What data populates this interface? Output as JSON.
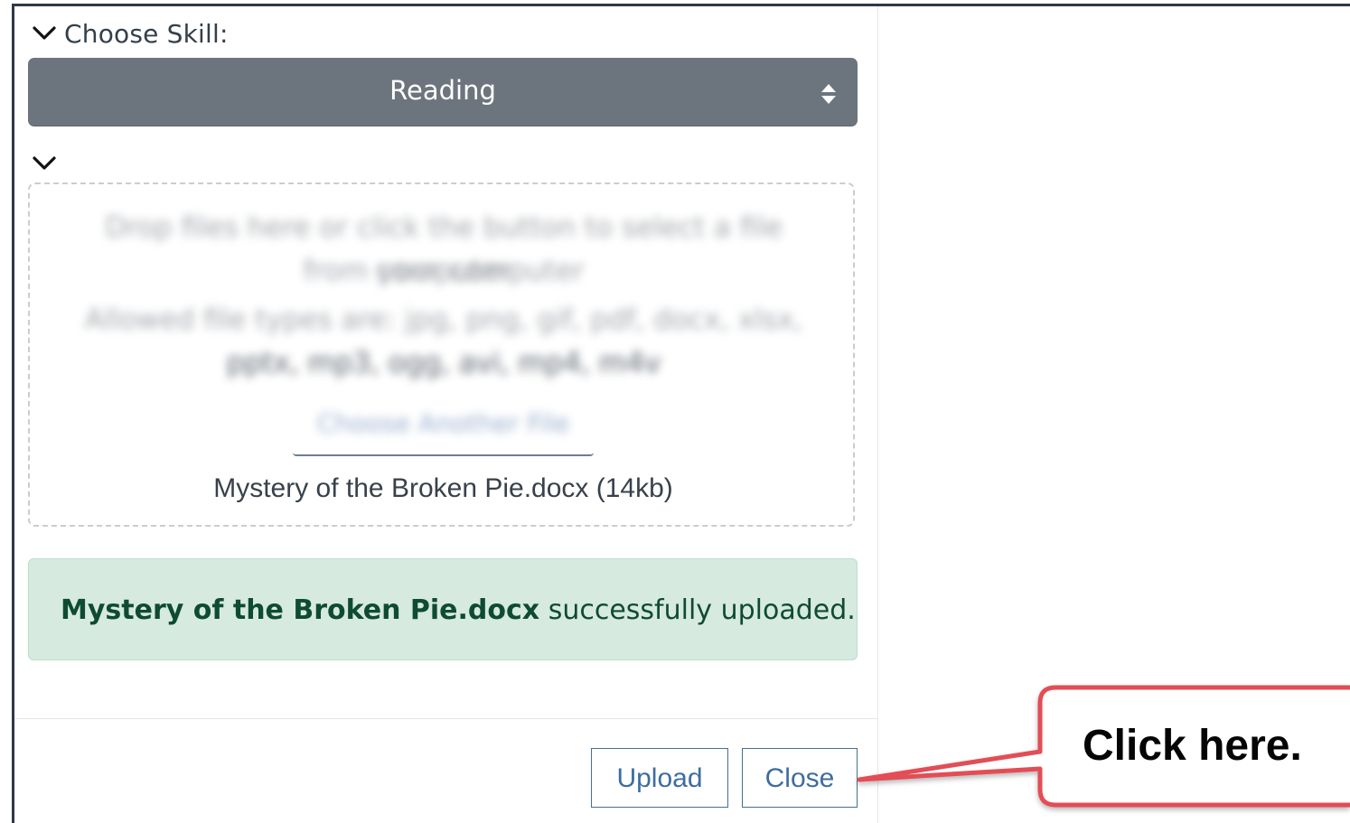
{
  "colors": {
    "frame": "#2f3945",
    "select_background": "#6c757d",
    "alert_background": "#d7eadf",
    "alert_text": "#0e4b33",
    "button_text": "#3e6d9e",
    "callout_border": "#e34e55",
    "callout_text": "#050505"
  },
  "icons": {
    "collapse": "chevron-down-icon",
    "select": "sort-icon"
  },
  "form": {
    "choose_skill_label": "Choose Skill:",
    "skill_selected": "Reading"
  },
  "upload": {
    "dropzone_instructions_blurred": "Drop files here or click the button to select a file from your computer",
    "allowed_types_blurred": "Allowed file types are: jpg, png, gif, pdf, docx, xlsx, pptx, mp3, ogg, avi, mp4, m4v",
    "choose_file_button_blurred": "Choose Another File",
    "selected_file": "Mystery of the Broken Pie.docx (14kb)",
    "success_filename": "Mystery of the Broken Pie.docx",
    "success_message": "successfully uploaded."
  },
  "actions": {
    "upload": "Upload",
    "close": "Close"
  },
  "callout": {
    "text": "Click here."
  }
}
